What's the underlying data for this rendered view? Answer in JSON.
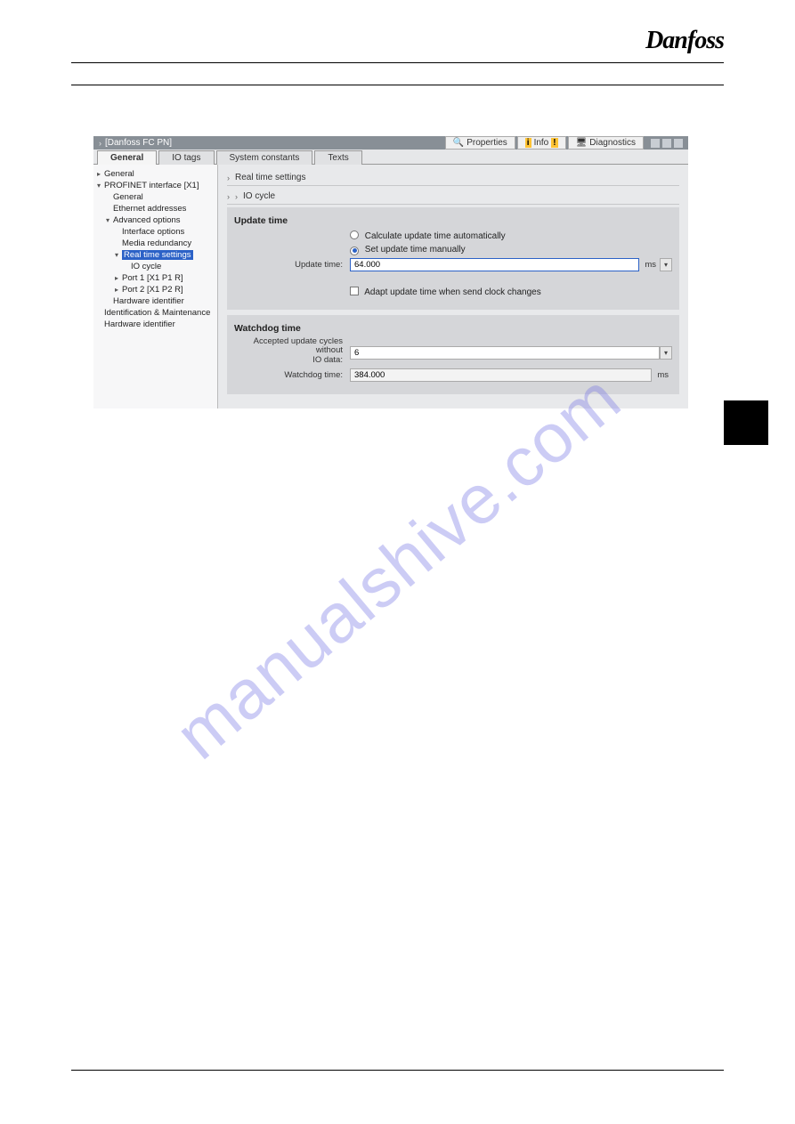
{
  "brand_logo_text": "Danfoss",
  "watermark_text": "manualshive.com",
  "screenshot": {
    "window_title": "[Danfoss FC PN]",
    "top_buttons": {
      "properties": "Properties",
      "info": "Info",
      "diagnostics": "Diagnostics"
    },
    "tabs": {
      "general": "General",
      "io_tags": "IO tags",
      "system_constants": "System constants",
      "texts": "Texts"
    },
    "sidebar": {
      "general": "General",
      "profinet_interface": "PROFINET interface [X1]",
      "pi_general": "General",
      "ethernet_addresses": "Ethernet addresses",
      "advanced_options": "Advanced options",
      "interface_options": "Interface options",
      "media_redundancy": "Media redundancy",
      "real_time_settings": "Real time settings",
      "io_cycle": "IO cycle",
      "port1": "Port 1 [X1 P1 R]",
      "port2": "Port 2 [X1 P2 R]",
      "hardware_identifier1": "Hardware identifier",
      "ident_maint": "Identification & Maintenance",
      "hardware_identifier2": "Hardware identifier"
    },
    "main": {
      "crumb1": "Real time settings",
      "crumb2": "IO cycle",
      "section_update_title": "Update time",
      "radio_auto": "Calculate update time automatically",
      "radio_manual": "Set update time manually",
      "update_time_label": "Update time:",
      "update_time_value": "64.000",
      "update_time_unit": "ms",
      "adapt_checkbox": "Adapt update time when send clock changes",
      "section_watchdog_title": "Watchdog time",
      "accepted_label_line1": "Accepted update cycles without",
      "accepted_label_line2": "IO data:",
      "accepted_value": "6",
      "watchdog_label": "Watchdog time:",
      "watchdog_value": "384.000",
      "watchdog_unit": "ms"
    }
  }
}
